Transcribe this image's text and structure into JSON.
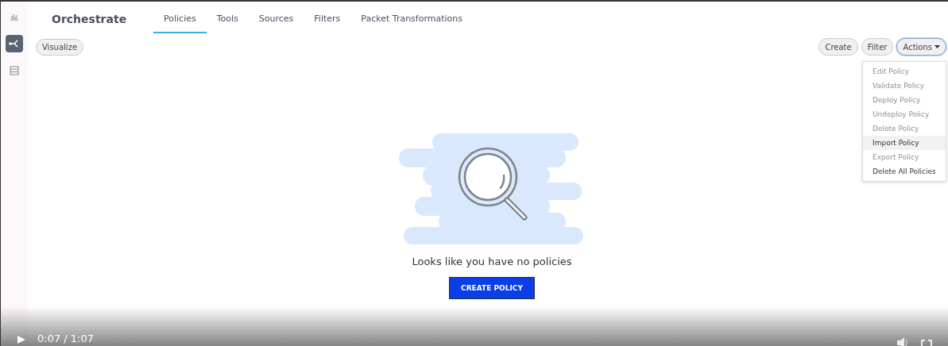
{
  "app": {
    "title": "Orchestrate"
  },
  "sidebar": {
    "items": [
      {
        "selected": false
      },
      {
        "selected": true
      },
      {
        "selected": false
      }
    ]
  },
  "tabs": [
    {
      "label": "Policies",
      "selected": true
    },
    {
      "label": "Tools",
      "selected": false
    },
    {
      "label": "Sources",
      "selected": false
    },
    {
      "label": "Filters",
      "selected": false
    },
    {
      "label": "Packet Transformations",
      "selected": false
    }
  ],
  "toolbar": {
    "left": [
      "Visualize"
    ],
    "right": [
      "Create",
      "Filter"
    ],
    "actions": {
      "label": "Actions",
      "expanded": true
    }
  },
  "actions_menu": [
    {
      "label": "Edit Policy",
      "disabled": true,
      "selected": false
    },
    {
      "label": "Validate Policy",
      "disabled": true,
      "selected": false
    },
    {
      "label": "Deploy Policy",
      "disabled": true,
      "selected": false
    },
    {
      "label": "Undeploy Policy",
      "disabled": true,
      "selected": false
    },
    {
      "label": "Delete Policy",
      "disabled": true,
      "selected": false
    },
    {
      "label": "Import Policy",
      "disabled": false,
      "selected": true
    },
    {
      "label": "Export Policy",
      "disabled": true,
      "selected": false
    },
    {
      "label": "Delete All Policies",
      "disabled": false,
      "selected": false
    }
  ],
  "empty_state": {
    "message": "Looks like you have no policies",
    "button": "CREATE POLICY"
  },
  "video_player": {
    "time": "0:07 / 1:07"
  }
}
